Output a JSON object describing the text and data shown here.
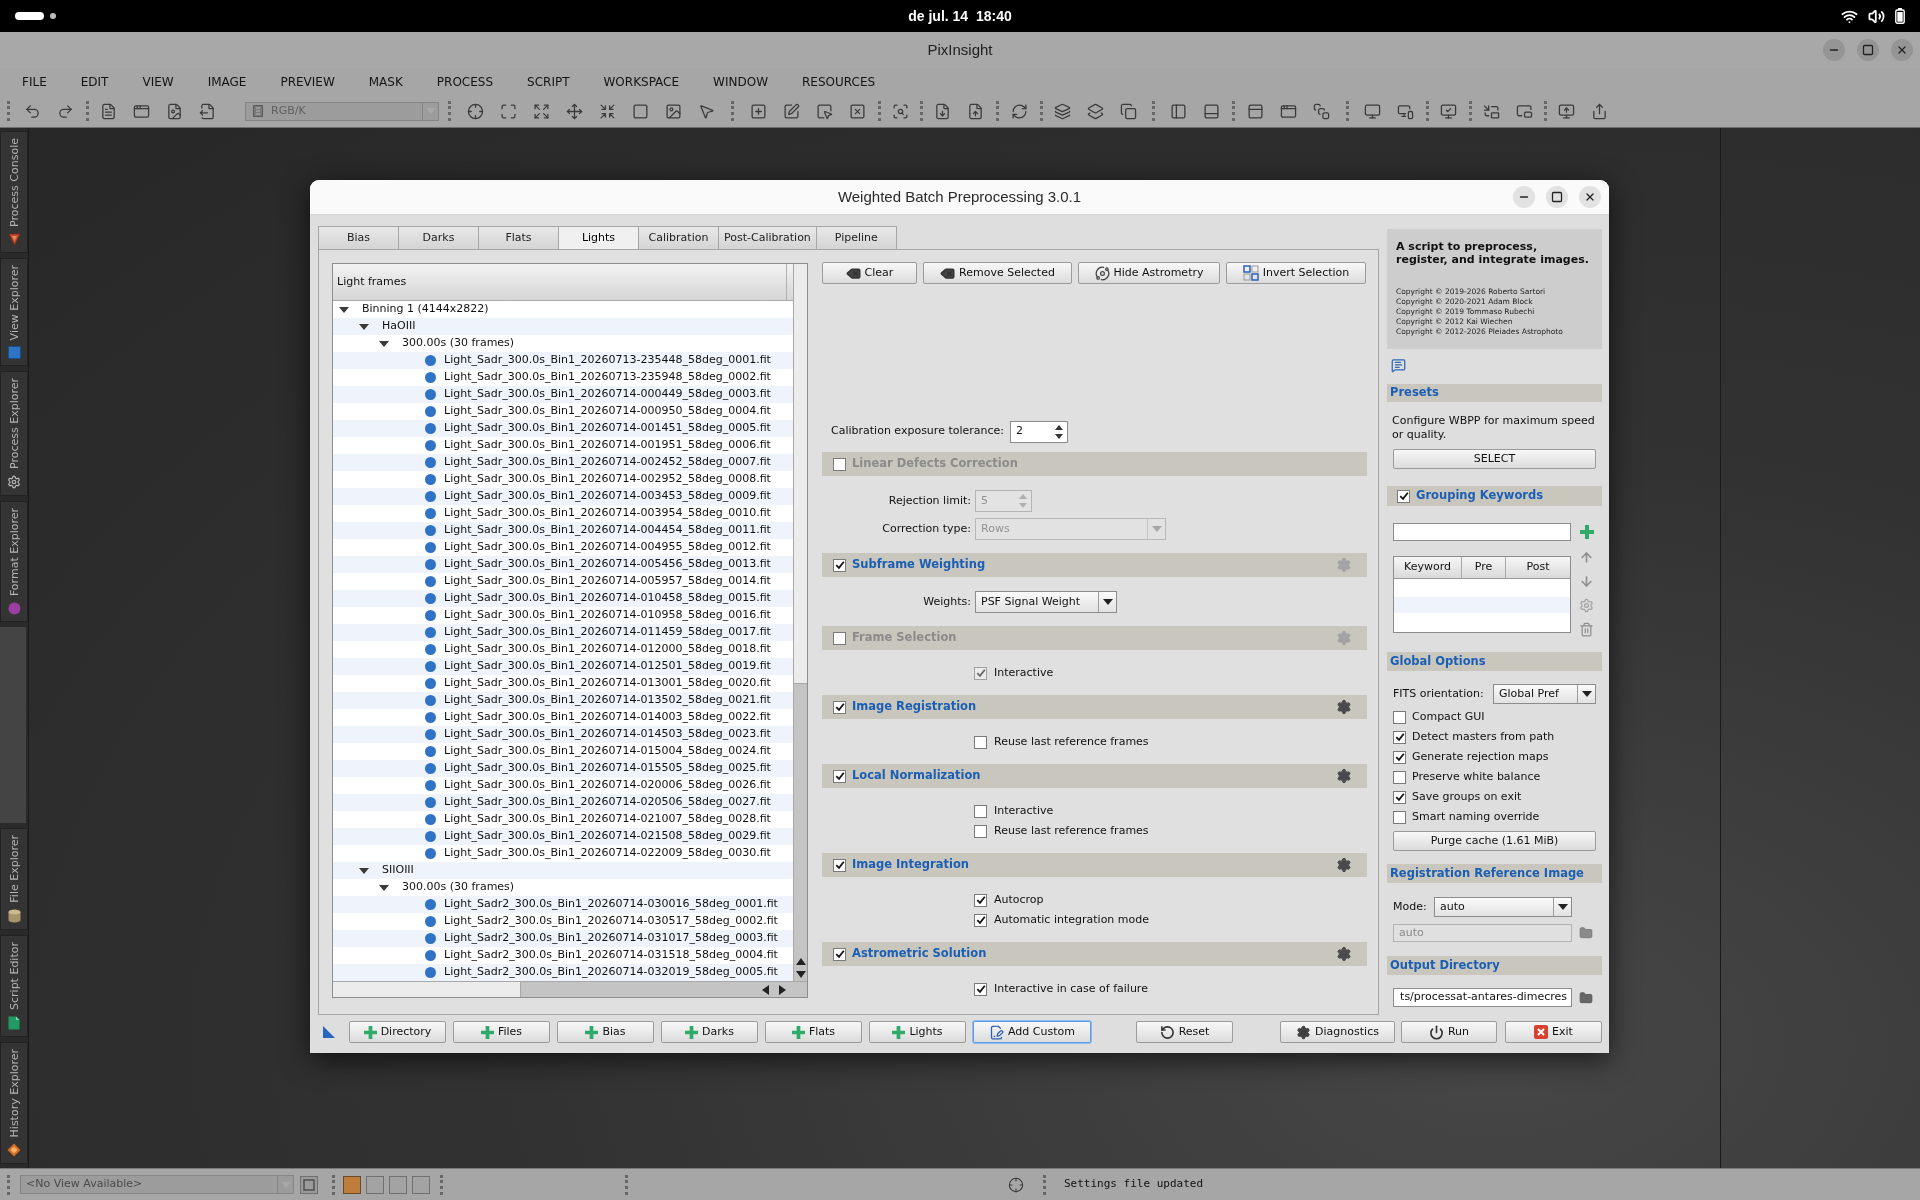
{
  "top_bar": {
    "clock": "de jul. 14  18:40"
  },
  "app_window": {
    "title": "PixInsight"
  },
  "menu_bar": [
    "FILE",
    "EDIT",
    "VIEW",
    "IMAGE",
    "PREVIEW",
    "MASK",
    "PROCESS",
    "SCRIPT",
    "WORKSPACE",
    "WINDOW",
    "RESOURCES"
  ],
  "toolbar": {
    "color_space": {
      "value": "RGB/K",
      "disabled": true
    }
  },
  "side_panels": {
    "top": [
      {
        "label": "Process Console"
      },
      {
        "label": "View Explorer"
      },
      {
        "label": "Process Explorer"
      },
      {
        "label": "Format Explorer"
      }
    ],
    "bottom": [
      {
        "label": "File Explorer"
      },
      {
        "label": "Script Editor"
      },
      {
        "label": "History Explorer"
      }
    ]
  },
  "dialog": {
    "title": "Weighted Batch Preprocessing 3.0.1",
    "tabs": [
      {
        "label": "Bias",
        "selected": false
      },
      {
        "label": "Darks",
        "selected": false
      },
      {
        "label": "Flats",
        "selected": false
      },
      {
        "label": "Lights",
        "selected": true
      },
      {
        "label": "Calibration",
        "selected": false
      },
      {
        "label": "Post-Calibration",
        "selected": false
      },
      {
        "label": "Pipeline",
        "selected": false
      }
    ],
    "file_tree": {
      "header": "Light frames",
      "items": [
        {
          "label": "Binning 1 (4144x2822)",
          "expanded": true,
          "children": [
            {
              "label": "HaOIII",
              "expanded": true,
              "children": [
                {
                  "label": "300.00s (30 frames)",
                  "expanded": true,
                  "children": [
                    {
                      "label": "Light_Sadr_300.0s_Bin1_20260713-235448_58deg_0001.fit"
                    },
                    {
                      "label": "Light_Sadr_300.0s_Bin1_20260713-235948_58deg_0002.fit"
                    },
                    {
                      "label": "Light_Sadr_300.0s_Bin1_20260714-000449_58deg_0003.fit"
                    },
                    {
                      "label": "Light_Sadr_300.0s_Bin1_20260714-000950_58deg_0004.fit"
                    },
                    {
                      "label": "Light_Sadr_300.0s_Bin1_20260714-001451_58deg_0005.fit"
                    },
                    {
                      "label": "Light_Sadr_300.0s_Bin1_20260714-001951_58deg_0006.fit"
                    },
                    {
                      "label": "Light_Sadr_300.0s_Bin1_20260714-002452_58deg_0007.fit"
                    },
                    {
                      "label": "Light_Sadr_300.0s_Bin1_20260714-002952_58deg_0008.fit"
                    },
                    {
                      "label": "Light_Sadr_300.0s_Bin1_20260714-003453_58deg_0009.fit"
                    },
                    {
                      "label": "Light_Sadr_300.0s_Bin1_20260714-003954_58deg_0010.fit"
                    },
                    {
                      "label": "Light_Sadr_300.0s_Bin1_20260714-004454_58deg_0011.fit"
                    },
                    {
                      "label": "Light_Sadr_300.0s_Bin1_20260714-004955_58deg_0012.fit"
                    },
                    {
                      "label": "Light_Sadr_300.0s_Bin1_20260714-005456_58deg_0013.fit"
                    },
                    {
                      "label": "Light_Sadr_300.0s_Bin1_20260714-005957_58deg_0014.fit"
                    },
                    {
                      "label": "Light_Sadr_300.0s_Bin1_20260714-010458_58deg_0015.fit"
                    },
                    {
                      "label": "Light_Sadr_300.0s_Bin1_20260714-010958_58deg_0016.fit"
                    },
                    {
                      "label": "Light_Sadr_300.0s_Bin1_20260714-011459_58deg_0017.fit"
                    },
                    {
                      "label": "Light_Sadr_300.0s_Bin1_20260714-012000_58deg_0018.fit"
                    },
                    {
                      "label": "Light_Sadr_300.0s_Bin1_20260714-012501_58deg_0019.fit"
                    },
                    {
                      "label": "Light_Sadr_300.0s_Bin1_20260714-013001_58deg_0020.fit"
                    },
                    {
                      "label": "Light_Sadr_300.0s_Bin1_20260714-013502_58deg_0021.fit"
                    },
                    {
                      "label": "Light_Sadr_300.0s_Bin1_20260714-014003_58deg_0022.fit"
                    },
                    {
                      "label": "Light_Sadr_300.0s_Bin1_20260714-014503_58deg_0023.fit"
                    },
                    {
                      "label": "Light_Sadr_300.0s_Bin1_20260714-015004_58deg_0024.fit"
                    },
                    {
                      "label": "Light_Sadr_300.0s_Bin1_20260714-015505_58deg_0025.fit"
                    },
                    {
                      "label": "Light_Sadr_300.0s_Bin1_20260714-020006_58deg_0026.fit"
                    },
                    {
                      "label": "Light_Sadr_300.0s_Bin1_20260714-020506_58deg_0027.fit"
                    },
                    {
                      "label": "Light_Sadr_300.0s_Bin1_20260714-021007_58deg_0028.fit"
                    },
                    {
                      "label": "Light_Sadr_300.0s_Bin1_20260714-021508_58deg_0029.fit"
                    },
                    {
                      "label": "Light_Sadr_300.0s_Bin1_20260714-022009_58deg_0030.fit"
                    }
                  ]
                }
              ]
            },
            {
              "label": "SIIOIII",
              "expanded": true,
              "children": [
                {
                  "label": "300.00s (30 frames)",
                  "expanded": true,
                  "children": [
                    {
                      "label": "Light_Sadr2_300.0s_Bin1_20260714-030016_58deg_0001.fit"
                    },
                    {
                      "label": "Light_Sadr2_300.0s_Bin1_20260714-030517_58deg_0002.fit"
                    },
                    {
                      "label": "Light_Sadr2_300.0s_Bin1_20260714-031017_58deg_0003.fit"
                    },
                    {
                      "label": "Light_Sadr2_300.0s_Bin1_20260714-031518_58deg_0004.fit"
                    },
                    {
                      "label": "Light_Sadr2_300.0s_Bin1_20260714-032019_58deg_0005.fit"
                    }
                  ]
                }
              ]
            }
          ]
        }
      ]
    },
    "file_actions": [
      {
        "label": "Clear",
        "kind": "clear"
      },
      {
        "label": "Remove Selected",
        "kind": "remove"
      },
      {
        "label": "Hide Astrometry",
        "kind": "astrometry"
      },
      {
        "label": "Invert Selection",
        "kind": "invert"
      }
    ],
    "exposure_tolerance": {
      "label": "Calibration exposure tolerance:",
      "value": "2"
    },
    "sections": [
      {
        "title": "Linear Defects Correction",
        "checked": false,
        "items": [
          {
            "kind": "spin",
            "label": "Rejection limit:",
            "value": "5",
            "disabled": true
          },
          {
            "kind": "select",
            "label": "Correction type:",
            "value": "Rows",
            "disabled": true
          }
        ]
      },
      {
        "title": "Subframe Weighting",
        "checked": true,
        "settings": {
          "enabled": false
        },
        "items": [
          {
            "kind": "select",
            "label": "Weights:",
            "value": "PSF Signal Weight",
            "disabled": false
          }
        ]
      },
      {
        "title": "Frame Selection",
        "checked": false,
        "settings": {
          "enabled": false
        },
        "items": [
          {
            "kind": "checkbox",
            "label": "Interactive",
            "checked": true,
            "disabled": true
          }
        ]
      },
      {
        "title": "Image Registration",
        "checked": true,
        "settings": {
          "enabled": true
        },
        "items": [
          {
            "kind": "checkbox",
            "label": "Reuse last reference frames",
            "checked": false,
            "disabled": false
          }
        ]
      },
      {
        "title": "Local Normalization",
        "checked": true,
        "settings": {
          "enabled": true
        },
        "items": [
          {
            "kind": "checkbox",
            "label": "Interactive",
            "checked": false,
            "disabled": false
          },
          {
            "kind": "checkbox",
            "label": "Reuse last reference frames",
            "checked": false,
            "disabled": false
          }
        ]
      },
      {
        "title": "Image Integration",
        "checked": true,
        "settings": {
          "enabled": true
        },
        "items": [
          {
            "kind": "checkbox",
            "label": "Autocrop",
            "checked": true,
            "disabled": false
          },
          {
            "kind": "checkbox",
            "label": "Automatic integration mode",
            "checked": true,
            "disabled": false
          }
        ]
      },
      {
        "title": "Astrometric Solution",
        "checked": true,
        "settings": {
          "enabled": true
        },
        "items": [
          {
            "kind": "checkbox",
            "label": "Interactive in case of failure",
            "checked": true,
            "disabled": false
          }
        ]
      }
    ],
    "about": {
      "heading": "A script to preprocess, register, and integrate images.",
      "credits": [
        "Copyright © 2019-2026 Roberto Sartori",
        "Copyright © 2020-2021 Adam Block",
        "Copyright © 2019 Tommaso Rubechi",
        "Copyright © 2012 Kai Wiechen",
        "Copyright © 2012-2026 Pleiades Astrophoto"
      ]
    },
    "presets": {
      "title": "Presets",
      "description": "Configure WBPP for maximum speed or quality.",
      "button": "SELECT"
    },
    "grouping_keywords": {
      "title": "Grouping Keywords",
      "checked": true,
      "columns": [
        "Keyword",
        "Pre",
        "Post"
      ]
    },
    "global_options": {
      "title": "Global Options",
      "fits_orientation": {
        "label": "FITS orientation:",
        "value": "Global Pref"
      },
      "options": [
        {
          "label": "Compact GUI",
          "checked": false
        },
        {
          "label": "Detect masters from path",
          "checked": true
        },
        {
          "label": "Generate rejection maps",
          "checked": true
        },
        {
          "label": "Preserve white balance",
          "checked": false
        },
        {
          "label": "Save groups on exit",
          "checked": true
        },
        {
          "label": "Smart naming override",
          "checked": false
        }
      ],
      "purge_button": "Purge cache (1.61 MiB)"
    },
    "registration_reference": {
      "title": "Registration Reference Image",
      "mode": {
        "label": "Mode:",
        "value": "auto"
      },
      "reference": {
        "value": "auto",
        "disabled": true
      }
    },
    "output_directory": {
      "title": "Output Directory",
      "value": "ts/processat-antares-dimecres"
    },
    "bottom_bar": {
      "add_buttons": [
        {
          "label": "Directory",
          "kind": "add",
          "focused": false
        },
        {
          "label": "Files",
          "kind": "add",
          "focused": false
        },
        {
          "label": "Bias",
          "kind": "add",
          "focused": false
        },
        {
          "label": "Darks",
          "kind": "add",
          "focused": false
        },
        {
          "label": "Flats",
          "kind": "add",
          "focused": false
        },
        {
          "label": "Lights",
          "kind": "add",
          "focused": false
        },
        {
          "label": "Add Custom",
          "kind": "custom",
          "focused": true
        }
      ],
      "reset_button": {
        "label": "Reset"
      },
      "action_buttons": [
        {
          "label": "Diagnostics",
          "kind": "diagnostics"
        },
        {
          "label": "Run",
          "kind": "run"
        },
        {
          "label": "Exit",
          "kind": "exit"
        }
      ]
    }
  },
  "status_bar": {
    "view_selector": {
      "value": "<No View Available>",
      "disabled": true
    },
    "message": "Settings file updated"
  }
}
